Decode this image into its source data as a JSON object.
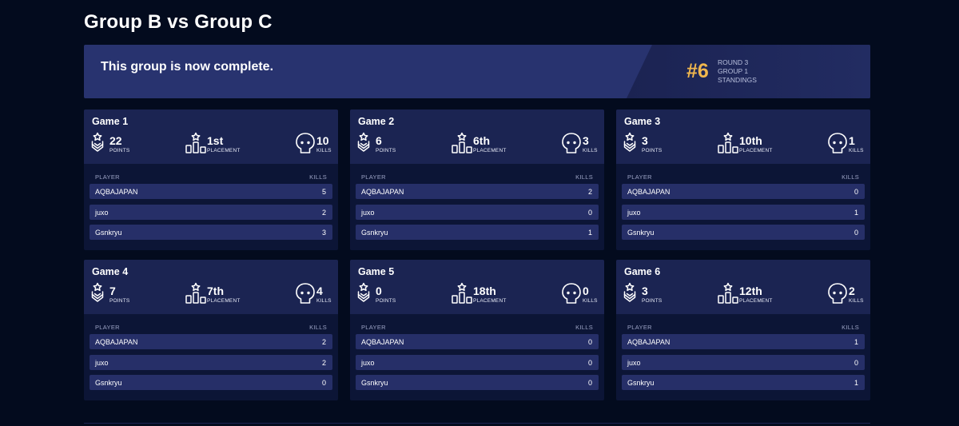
{
  "title": "Group B vs Group C",
  "banner": {
    "message": "This group is now complete.",
    "rank": "#6",
    "meta": [
      "ROUND 3",
      "GROUP 1",
      "STANDINGS"
    ]
  },
  "labels": {
    "points": "POINTS",
    "placement": "PLACEMENT",
    "kills": "KILLS",
    "col_player": "PLAYER",
    "col_kills": "KILLS"
  },
  "games": [
    {
      "title": "Game 1",
      "points": "22",
      "placement": "1st",
      "kills": "10",
      "players": [
        {
          "name": "AQBAJAPAN",
          "kills": "5"
        },
        {
          "name": "juxo",
          "kills": "2"
        },
        {
          "name": "Gsnkryu",
          "kills": "3"
        }
      ]
    },
    {
      "title": "Game 2",
      "points": "6",
      "placement": "6th",
      "kills": "3",
      "players": [
        {
          "name": "AQBAJAPAN",
          "kills": "2"
        },
        {
          "name": "juxo",
          "kills": "0"
        },
        {
          "name": "Gsnkryu",
          "kills": "1"
        }
      ]
    },
    {
      "title": "Game 3",
      "points": "3",
      "placement": "10th",
      "kills": "1",
      "players": [
        {
          "name": "AQBAJAPAN",
          "kills": "0"
        },
        {
          "name": "juxo",
          "kills": "1"
        },
        {
          "name": "Gsnkryu",
          "kills": "0"
        }
      ]
    },
    {
      "title": "Game 4",
      "points": "7",
      "placement": "7th",
      "kills": "4",
      "players": [
        {
          "name": "AQBAJAPAN",
          "kills": "2"
        },
        {
          "name": "juxo",
          "kills": "2"
        },
        {
          "name": "Gsnkryu",
          "kills": "0"
        }
      ]
    },
    {
      "title": "Game 5",
      "points": "0",
      "placement": "18th",
      "kills": "0",
      "players": [
        {
          "name": "AQBAJAPAN",
          "kills": "0"
        },
        {
          "name": "juxo",
          "kills": "0"
        },
        {
          "name": "Gsnkryu",
          "kills": "0"
        }
      ]
    },
    {
      "title": "Game 6",
      "points": "3",
      "placement": "12th",
      "kills": "2",
      "players": [
        {
          "name": "AQBAJAPAN",
          "kills": "1"
        },
        {
          "name": "juxo",
          "kills": "0"
        },
        {
          "name": "Gsnkryu",
          "kills": "1"
        }
      ]
    }
  ]
}
